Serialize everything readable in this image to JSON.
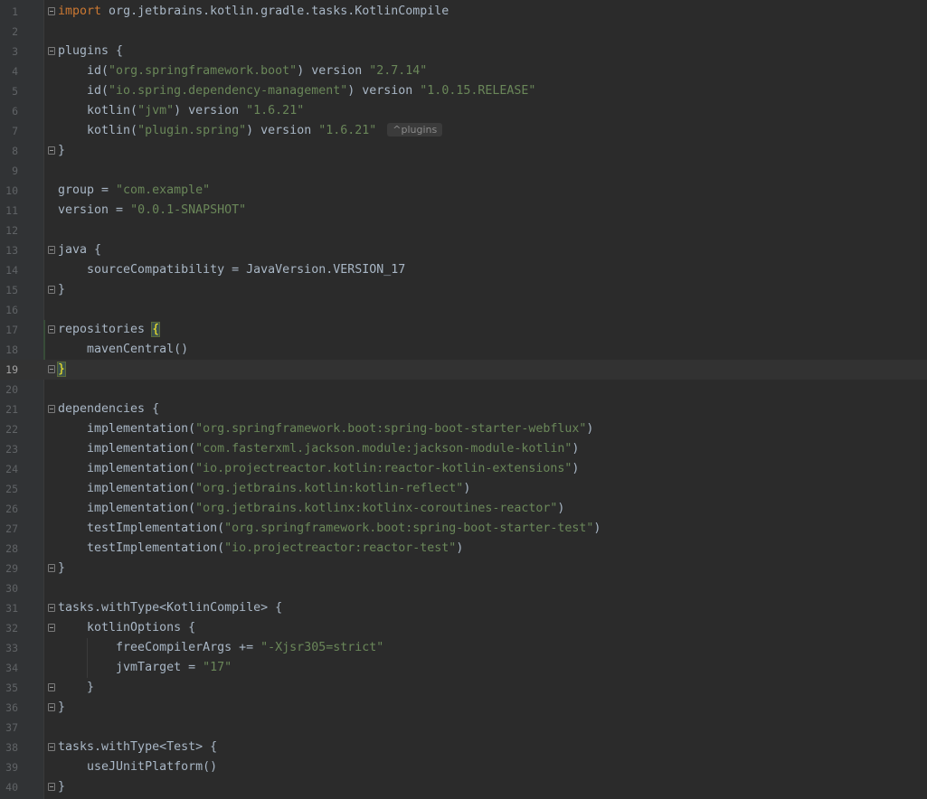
{
  "editor": {
    "language": "kotlin",
    "current_line": 19,
    "colors": {
      "background": "#2b2b2b",
      "gutter": "#313335",
      "line_number": "#606366",
      "text": "#a9b7c6",
      "keyword": "#cc7832",
      "string": "#6a8759",
      "brace_match": "#ffef28"
    },
    "lines": [
      {
        "no": "1",
        "fold": true,
        "tokens": [
          {
            "t": "kw",
            "v": "import"
          },
          {
            "t": "p",
            "v": " org.jetbrains.kotlin.gradle.tasks.KotlinCompile"
          }
        ]
      },
      {
        "no": "2",
        "tokens": []
      },
      {
        "no": "3",
        "fold": true,
        "tokens": [
          {
            "t": "p",
            "v": "plugins {"
          }
        ]
      },
      {
        "no": "4",
        "tokens": [
          {
            "t": "p",
            "v": "    id("
          },
          {
            "t": "s",
            "v": "\"org.springframework.boot\""
          },
          {
            "t": "p",
            "v": ") version "
          },
          {
            "t": "s",
            "v": "\"2.7.14\""
          }
        ]
      },
      {
        "no": "5",
        "tokens": [
          {
            "t": "p",
            "v": "    id("
          },
          {
            "t": "s",
            "v": "\"io.spring.dependency-management\""
          },
          {
            "t": "p",
            "v": ") version "
          },
          {
            "t": "s",
            "v": "\"1.0.15.RELEASE\""
          }
        ]
      },
      {
        "no": "6",
        "tokens": [
          {
            "t": "p",
            "v": "    kotlin("
          },
          {
            "t": "s",
            "v": "\"jvm\""
          },
          {
            "t": "p",
            "v": ") version "
          },
          {
            "t": "s",
            "v": "\"1.6.21\""
          }
        ]
      },
      {
        "no": "7",
        "tokens": [
          {
            "t": "p",
            "v": "    kotlin("
          },
          {
            "t": "s",
            "v": "\"plugin.spring\""
          },
          {
            "t": "p",
            "v": ") version "
          },
          {
            "t": "s",
            "v": "\"1.6.21\""
          },
          {
            "t": "hint",
            "v": "^plugins"
          }
        ]
      },
      {
        "no": "8",
        "fold": true,
        "tokens": [
          {
            "t": "p",
            "v": "}"
          }
        ]
      },
      {
        "no": "9",
        "tokens": []
      },
      {
        "no": "10",
        "tokens": [
          {
            "t": "p",
            "v": "group = "
          },
          {
            "t": "s",
            "v": "\"com.example\""
          }
        ]
      },
      {
        "no": "11",
        "tokens": [
          {
            "t": "p",
            "v": "version = "
          },
          {
            "t": "s",
            "v": "\"0.0.1-SNAPSHOT\""
          }
        ]
      },
      {
        "no": "12",
        "tokens": []
      },
      {
        "no": "13",
        "fold": true,
        "tokens": [
          {
            "t": "p",
            "v": "java {"
          }
        ]
      },
      {
        "no": "14",
        "tokens": [
          {
            "t": "p",
            "v": "    sourceCompatibility = JavaVersion.VERSION_17"
          }
        ]
      },
      {
        "no": "15",
        "fold": true,
        "tokens": [
          {
            "t": "p",
            "v": "}"
          }
        ]
      },
      {
        "no": "16",
        "tokens": []
      },
      {
        "no": "17",
        "fold": true,
        "tokens": [
          {
            "t": "p",
            "v": "repositories "
          },
          {
            "t": "b",
            "v": "{"
          }
        ]
      },
      {
        "no": "18",
        "tokens": [
          {
            "t": "p",
            "v": "    mavenCentral()"
          }
        ]
      },
      {
        "no": "19",
        "fold": true,
        "tokens": [
          {
            "t": "b",
            "v": "}"
          }
        ]
      },
      {
        "no": "20",
        "tokens": []
      },
      {
        "no": "21",
        "fold": true,
        "tokens": [
          {
            "t": "p",
            "v": "dependencies {"
          }
        ]
      },
      {
        "no": "22",
        "tokens": [
          {
            "t": "p",
            "v": "    implementation("
          },
          {
            "t": "s",
            "v": "\"org.springframework.boot:spring-boot-starter-webflux\""
          },
          {
            "t": "p",
            "v": ")"
          }
        ]
      },
      {
        "no": "23",
        "tokens": [
          {
            "t": "p",
            "v": "    implementation("
          },
          {
            "t": "s",
            "v": "\"com.fasterxml.jackson.module:jackson-module-kotlin\""
          },
          {
            "t": "p",
            "v": ")"
          }
        ]
      },
      {
        "no": "24",
        "tokens": [
          {
            "t": "p",
            "v": "    implementation("
          },
          {
            "t": "s",
            "v": "\"io.projectreactor.kotlin:reactor-kotlin-extensions\""
          },
          {
            "t": "p",
            "v": ")"
          }
        ]
      },
      {
        "no": "25",
        "tokens": [
          {
            "t": "p",
            "v": "    implementation("
          },
          {
            "t": "s",
            "v": "\"org.jetbrains.kotlin:kotlin-reflect\""
          },
          {
            "t": "p",
            "v": ")"
          }
        ]
      },
      {
        "no": "26",
        "tokens": [
          {
            "t": "p",
            "v": "    implementation("
          },
          {
            "t": "s",
            "v": "\"org.jetbrains.kotlinx:kotlinx-coroutines-reactor\""
          },
          {
            "t": "p",
            "v": ")"
          }
        ]
      },
      {
        "no": "27",
        "tokens": [
          {
            "t": "p",
            "v": "    testImplementation("
          },
          {
            "t": "s",
            "v": "\"org.springframework.boot:spring-boot-starter-test\""
          },
          {
            "t": "p",
            "v": ")"
          }
        ]
      },
      {
        "no": "28",
        "tokens": [
          {
            "t": "p",
            "v": "    testImplementation("
          },
          {
            "t": "s",
            "v": "\"io.projectreactor:reactor-test\""
          },
          {
            "t": "p",
            "v": ")"
          }
        ]
      },
      {
        "no": "29",
        "fold": true,
        "tokens": [
          {
            "t": "p",
            "v": "}"
          }
        ]
      },
      {
        "no": "30",
        "tokens": []
      },
      {
        "no": "31",
        "fold": true,
        "tokens": [
          {
            "t": "p",
            "v": "tasks.withType<KotlinCompile> {"
          }
        ]
      },
      {
        "no": "32",
        "fold": true,
        "tokens": [
          {
            "t": "p",
            "v": "    kotlinOptions {"
          }
        ]
      },
      {
        "no": "33",
        "tokens": [
          {
            "t": "p",
            "v": "        freeCompilerArgs += "
          },
          {
            "t": "s",
            "v": "\"-Xjsr305=strict\""
          }
        ]
      },
      {
        "no": "34",
        "tokens": [
          {
            "t": "p",
            "v": "        jvmTarget = "
          },
          {
            "t": "s",
            "v": "\"17\""
          }
        ]
      },
      {
        "no": "35",
        "fold": true,
        "tokens": [
          {
            "t": "p",
            "v": "    }"
          }
        ]
      },
      {
        "no": "36",
        "fold": true,
        "tokens": [
          {
            "t": "p",
            "v": "}"
          }
        ]
      },
      {
        "no": "37",
        "tokens": []
      },
      {
        "no": "38",
        "fold": true,
        "tokens": [
          {
            "t": "p",
            "v": "tasks.withType<Test> {"
          }
        ]
      },
      {
        "no": "39",
        "tokens": [
          {
            "t": "p",
            "v": "    useJUnitPlatform()"
          }
        ]
      },
      {
        "no": "40",
        "fold": true,
        "tokens": [
          {
            "t": "p",
            "v": "}"
          }
        ]
      }
    ]
  }
}
